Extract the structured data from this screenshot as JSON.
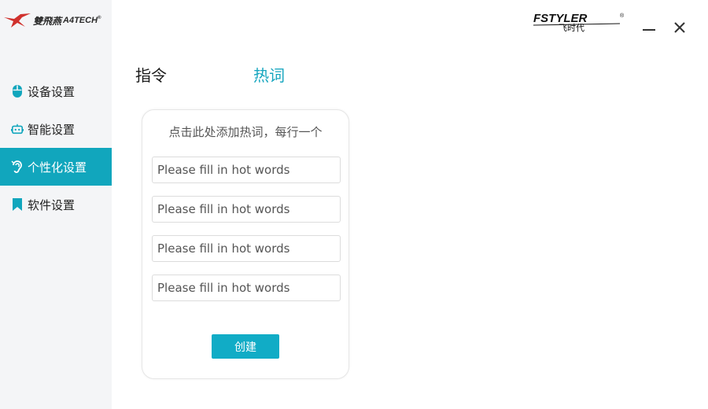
{
  "brand": {
    "cn": "雙飛燕",
    "en": "A4TECH",
    "mark": "®"
  },
  "topright_logo": {
    "line1": "FSTYLER",
    "line2": "飞时代",
    "mark": "®"
  },
  "window": {
    "minimize_glyph": "—",
    "close_glyph": "✕"
  },
  "sidebar": {
    "items": [
      {
        "label": "设备设置",
        "icon": "mouse-icon",
        "active": false
      },
      {
        "label": "智能设置",
        "icon": "robot-icon",
        "active": false
      },
      {
        "label": "个性化设置",
        "icon": "ear-icon",
        "active": true
      },
      {
        "label": "软件设置",
        "icon": "bookmark-icon",
        "active": false
      }
    ]
  },
  "tabs": [
    {
      "label": "指令",
      "active": false
    },
    {
      "label": "热词",
      "active": true
    }
  ],
  "hotwords": {
    "hint": "点击此处添加热词，每行一个",
    "placeholder": "Please fill in hot words",
    "inputs": [
      "",
      "",
      "",
      ""
    ],
    "create_label": "创建"
  },
  "colors": {
    "accent": "#11a6bd",
    "sidebar_bg": "#f4f5f7",
    "brand_red": "#d0312d"
  }
}
